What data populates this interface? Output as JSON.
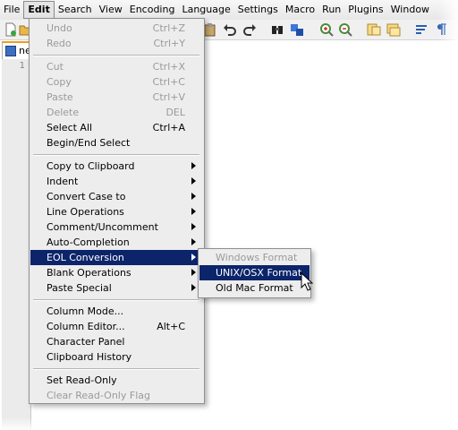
{
  "menubar": {
    "items": [
      {
        "label": "File"
      },
      {
        "label": "Edit"
      },
      {
        "label": "Search"
      },
      {
        "label": "View"
      },
      {
        "label": "Encoding"
      },
      {
        "label": "Language"
      },
      {
        "label": "Settings"
      },
      {
        "label": "Macro"
      },
      {
        "label": "Run"
      },
      {
        "label": "Plugins"
      },
      {
        "label": "Window"
      }
    ]
  },
  "editor": {
    "tab_label": "ne",
    "line_number": "1"
  },
  "edit_menu": {
    "undo": {
      "label": "Undo",
      "shortcut": "Ctrl+Z"
    },
    "redo": {
      "label": "Redo",
      "shortcut": "Ctrl+Y"
    },
    "cut": {
      "label": "Cut",
      "shortcut": "Ctrl+X"
    },
    "copy": {
      "label": "Copy",
      "shortcut": "Ctrl+C"
    },
    "paste": {
      "label": "Paste",
      "shortcut": "Ctrl+V"
    },
    "delete": {
      "label": "Delete",
      "shortcut": "DEL"
    },
    "select_all": {
      "label": "Select All",
      "shortcut": "Ctrl+A"
    },
    "begin_end_select": {
      "label": "Begin/End Select"
    },
    "copy_to_clipboard": {
      "label": "Copy to Clipboard"
    },
    "indent": {
      "label": "Indent"
    },
    "convert_case": {
      "label": "Convert Case to"
    },
    "line_operations": {
      "label": "Line Operations"
    },
    "comment_uncomment": {
      "label": "Comment/Uncomment"
    },
    "auto_completion": {
      "label": "Auto-Completion"
    },
    "eol_conversion": {
      "label": "EOL Conversion"
    },
    "blank_operations": {
      "label": "Blank Operations"
    },
    "paste_special": {
      "label": "Paste Special"
    },
    "column_mode": {
      "label": "Column Mode..."
    },
    "column_editor": {
      "label": "Column Editor...",
      "shortcut": "Alt+C"
    },
    "character_panel": {
      "label": "Character Panel"
    },
    "clipboard_history": {
      "label": "Clipboard History"
    },
    "set_read_only": {
      "label": "Set Read-Only"
    },
    "clear_read_only": {
      "label": "Clear Read-Only Flag"
    }
  },
  "eol_submenu": {
    "windows": {
      "label": "Windows Format"
    },
    "unix": {
      "label": "UNIX/OSX Format"
    },
    "mac": {
      "label": "Old Mac Format"
    }
  },
  "colors": {
    "highlight": "#0b246a",
    "menu_bg": "#ededed",
    "disabled_text": "#9a9a9a",
    "tab_accent": "#f39c1b"
  }
}
